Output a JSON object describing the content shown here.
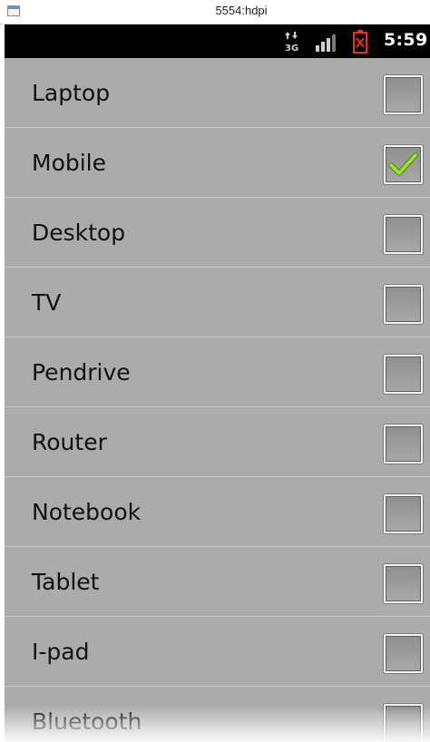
{
  "window": {
    "title": "5554:hdpi"
  },
  "status_bar": {
    "time": "5:59",
    "data_icon": "3g-data-icon",
    "signal_icon": "signal-strength-icon",
    "battery_icon": "battery-empty-icon"
  },
  "list": {
    "items": [
      {
        "label": "Laptop",
        "checked": false
      },
      {
        "label": "Mobile",
        "checked": true
      },
      {
        "label": "Desktop",
        "checked": false
      },
      {
        "label": "TV",
        "checked": false
      },
      {
        "label": "Pendrive",
        "checked": false
      },
      {
        "label": "Router",
        "checked": false
      },
      {
        "label": "Notebook",
        "checked": false
      },
      {
        "label": "Tablet",
        "checked": false
      },
      {
        "label": "I-pad",
        "checked": false
      },
      {
        "label": "Bluetooth",
        "checked": false
      }
    ]
  },
  "colors": {
    "list_background": "#ababab",
    "status_bar": "#000000",
    "check_green": "#7ed321",
    "battery_alert": "#e8321e"
  }
}
